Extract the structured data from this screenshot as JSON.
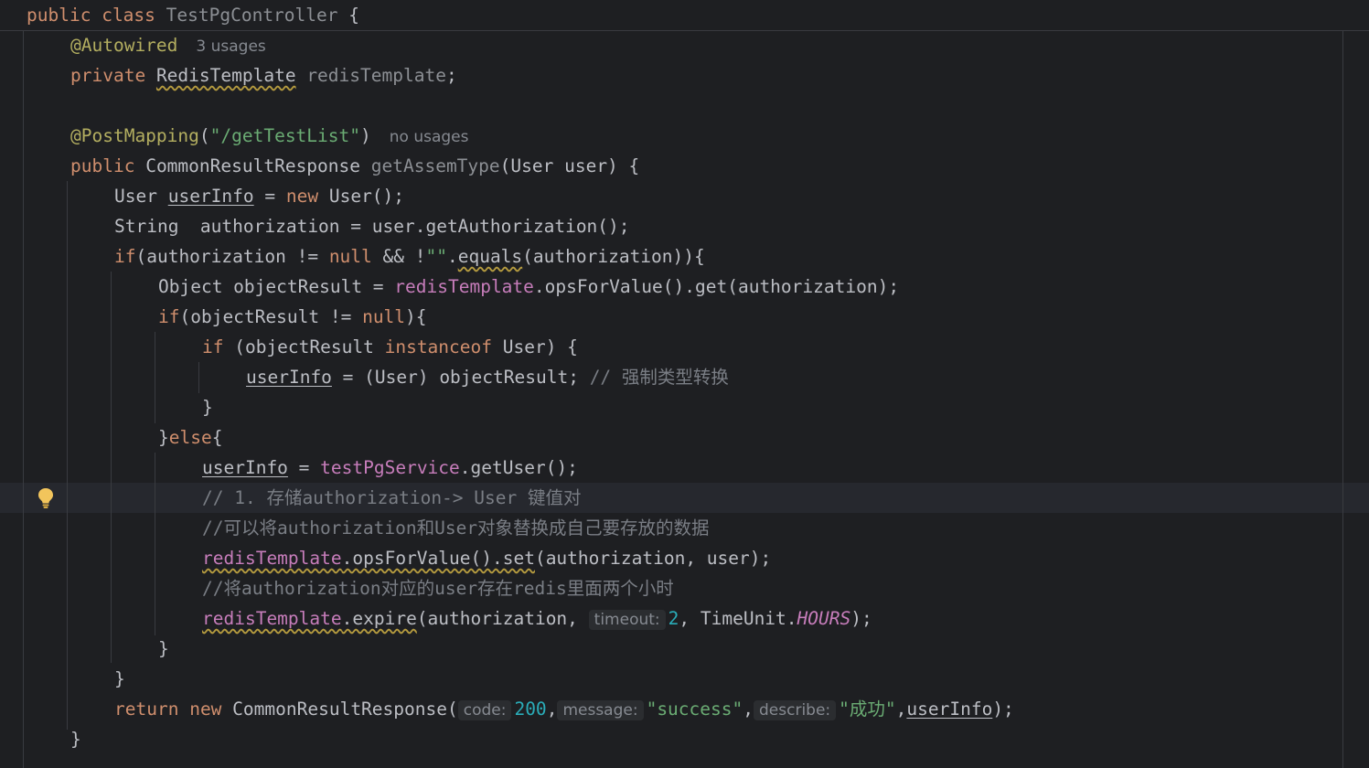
{
  "editor": {
    "class_decl": {
      "kw_public": "public",
      "kw_class": "class",
      "class_name": "TestPgController",
      "brace": "{"
    },
    "l1": {
      "annotation": "@Autowired",
      "usages": "3 usages"
    },
    "l2": {
      "kw_private": "private",
      "type": "RedisTemplate",
      "field": "redisTemplate",
      "semi": ";"
    },
    "l4": {
      "annotation": "@PostMapping",
      "paren_open": "(",
      "path": "\"/getTestList\"",
      "paren_close": ")",
      "usages": "no usages"
    },
    "l5": {
      "kw_public": "public",
      "return_type": "CommonResultResponse",
      "method": "getAssemType",
      "params": "(User user) {"
    },
    "l6": {
      "type": "User",
      "var": "userInfo",
      "eq": " = ",
      "kw_new": "new",
      "rest": " User();"
    },
    "l7": {
      "text": "String  authorization = user.getAuthorization();"
    },
    "l8": {
      "kw_if": "if",
      "a": "(authorization != ",
      "kw_null": "null",
      "b": " && !",
      "str": "\"\"",
      "dot": ".",
      "method": "equals",
      "c": "(authorization)){"
    },
    "l9": {
      "a": "Object objectResult = ",
      "field": "redisTemplate",
      "b": ".opsForValue().get(authorization);"
    },
    "l10": {
      "kw_if": "if",
      "a": "(objectResult != ",
      "kw_null": "null",
      "b": "){"
    },
    "l11": {
      "kw_if": "if",
      "a": " (objectResult ",
      "kw_instanceof": "instanceof",
      "b": " User) {"
    },
    "l12": {
      "var": "userInfo",
      "a": " = (User) objectResult; ",
      "comment": "// 强制类型转换"
    },
    "l13": {
      "text": "}"
    },
    "l14": {
      "a": "}",
      "kw_else": "else",
      "b": "{"
    },
    "l15": {
      "var": "userInfo",
      "a": " = ",
      "field": "testPgService",
      "b": ".getUser();"
    },
    "l16": {
      "comment": "// 1. 存储authorization-> User 键值对"
    },
    "l17": {
      "comment": "//可以将authorization和User对象替换成自己要存放的数据"
    },
    "l18": {
      "field": "redisTemplate",
      "call": ".opsForValue().set",
      "rest": "(authorization, user);"
    },
    "l19": {
      "comment": "//将authorization对应的user存在redis里面两个小时"
    },
    "l20": {
      "field": "redisTemplate",
      "call": ".expire",
      "a": "(authorization, ",
      "hint": "timeout:",
      "num": "2",
      "b": ", TimeUnit.",
      "static": "HOURS",
      "c": ");"
    },
    "l21": {
      "text": "}"
    },
    "l22": {
      "text": "}"
    },
    "l23": {
      "kw_return": "return",
      "kw_new": "new",
      "a": " CommonResultResponse(",
      "hint_code": "code:",
      "num": "200",
      "comma": ",",
      "hint_message": "message:",
      "str_success": "\"success\"",
      "hint_describe": "describe:",
      "str_cn": "\"成功\"",
      "var": "userInfo",
      "end": ");"
    },
    "l24": {
      "text": "}"
    }
  },
  "colors": {
    "background": "#1e1f22",
    "keyword": "#cf8e6d",
    "annotation": "#b3ae60",
    "string": "#6aab73",
    "number": "#2aacb8",
    "field": "#c77dbb",
    "comment": "#7a7e85",
    "caret_row": "#26282e"
  },
  "icons": {
    "gutter_intention": "lightbulb-icon"
  }
}
